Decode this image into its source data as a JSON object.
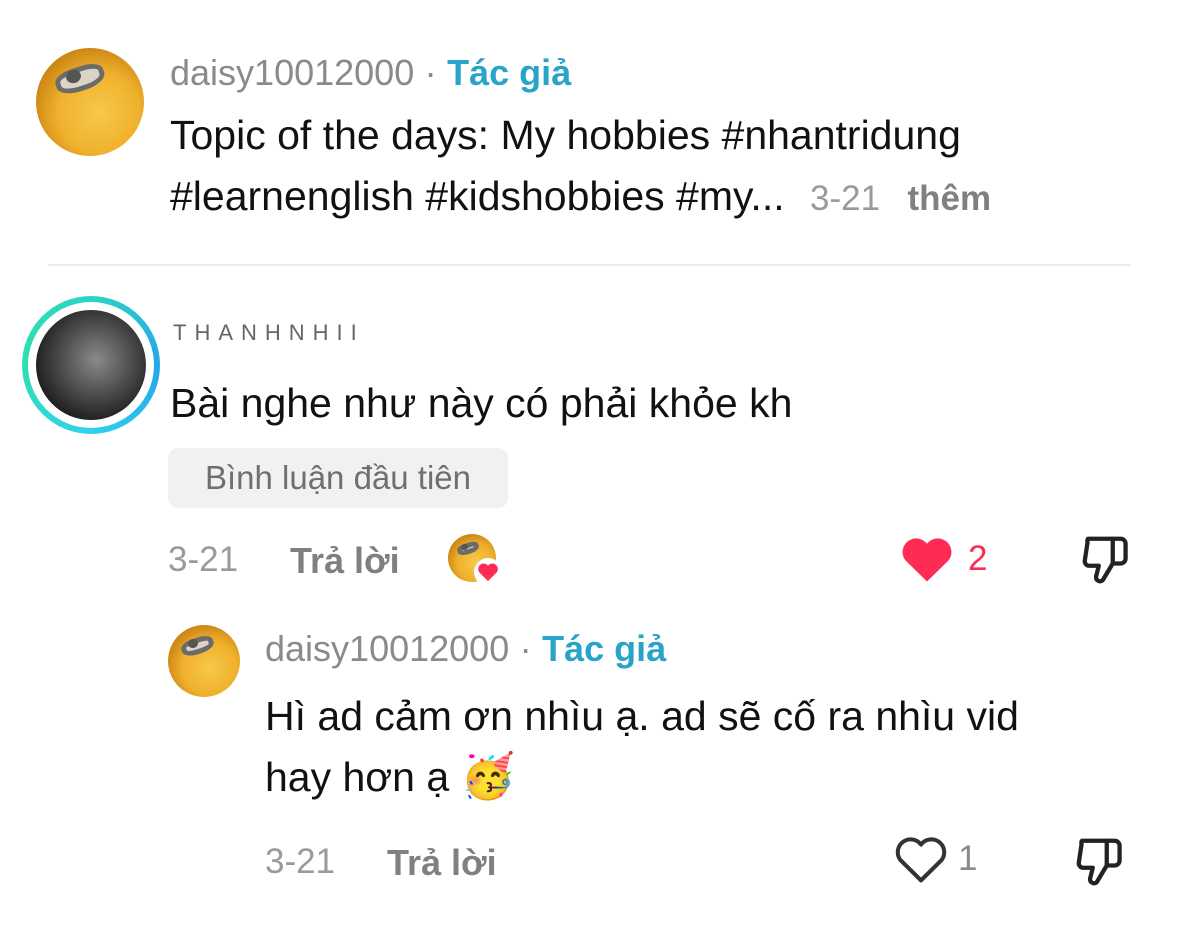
{
  "post": {
    "username": "daisy10012000",
    "separator": "·",
    "author_badge": "Tác giả",
    "caption_line1": "Topic of the days: My hobbies #nhantridung",
    "caption_line2": "#learnenglish #kidshobbies #my...",
    "date": "3-21",
    "more": "thêm"
  },
  "comment": {
    "username": "THANHNHII",
    "text": "Bài nghe như này có phải khỏe kh",
    "first_badge": "Bình luận đầu tiên",
    "date": "3-21",
    "reply_label": "Trả lời",
    "like_count": "2",
    "liked": true,
    "author_liked_icon": "author-liked-avatar-icon"
  },
  "reply": {
    "username": "daisy10012000",
    "separator": "·",
    "author_badge": "Tác giả",
    "text_line1": "Hì ad cảm ơn nhìu ạ. ad sẽ cố ra nhìu vid",
    "text_line2": "hay hơn ạ",
    "emoji": "🥳",
    "date": "3-21",
    "reply_label": "Trả lời",
    "like_count": "1",
    "liked": false
  },
  "colors": {
    "author": "#2aa3c9",
    "like_red": "#fe2c55",
    "muted": "#8a8a8a"
  }
}
